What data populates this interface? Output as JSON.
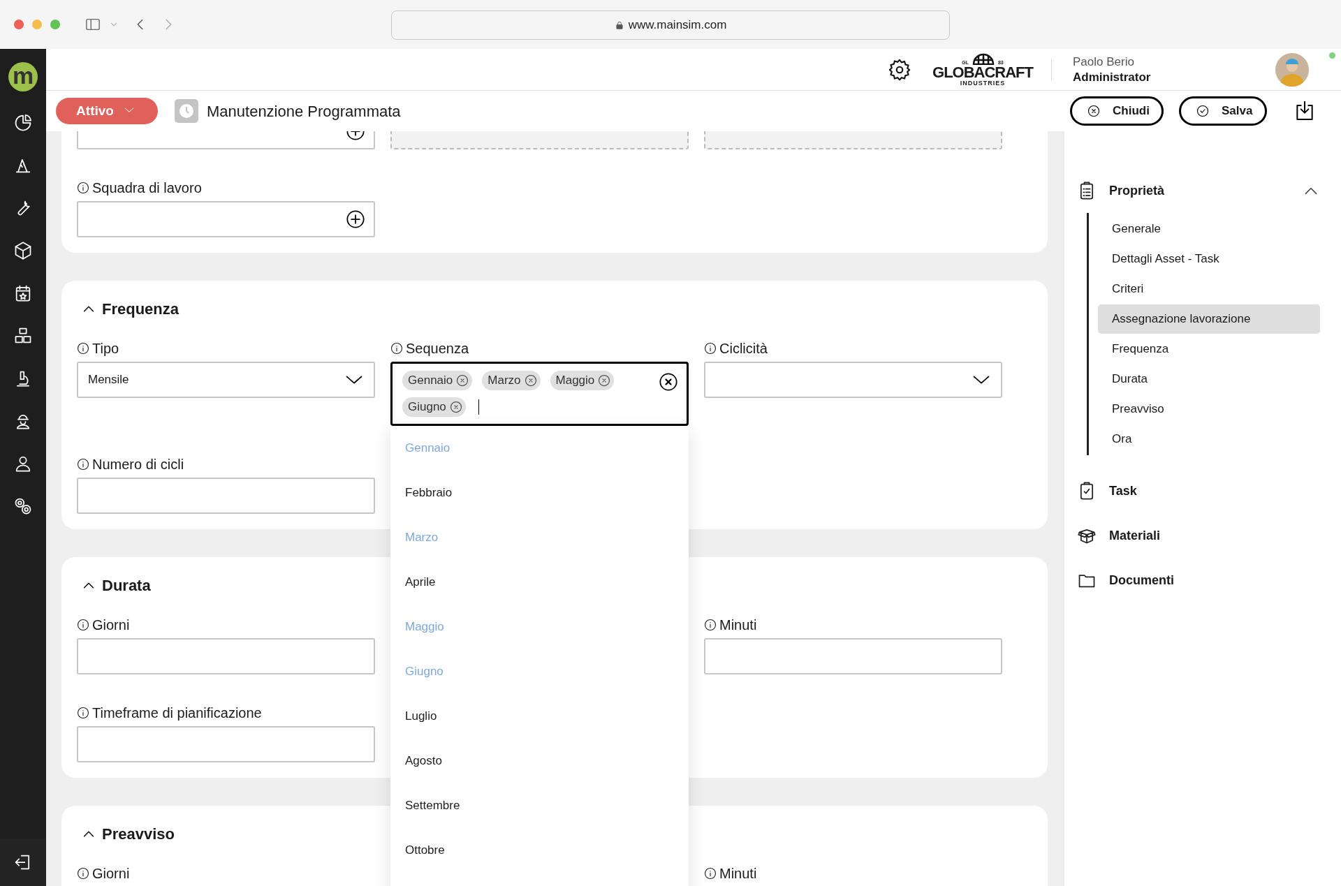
{
  "browser": {
    "url": "www.mainsim.com"
  },
  "sidebar": {
    "logo": "m"
  },
  "header": {
    "brand": {
      "name": "GLOBACRAFT",
      "left_mark": "GL",
      "right_mark": "83",
      "tagline": "INDUSTRIES"
    },
    "user": {
      "name": "Paolo Berio",
      "role": "Administrator"
    }
  },
  "toolbar": {
    "status": "Attivo",
    "title": "Manutenzione Programmata",
    "buttons": [
      {
        "label": "Chiudi",
        "kind": "close"
      },
      {
        "label": "Salva",
        "kind": "save"
      }
    ]
  },
  "sections": [
    {
      "rows": [
        [
          {
            "kind": "add"
          },
          {
            "kind": "dashed"
          },
          {
            "kind": "dashed"
          }
        ],
        [
          {
            "kind": "add",
            "label": "Squadra di lavoro"
          },
          null,
          null
        ]
      ]
    },
    {
      "title": "Frequenza",
      "expanded": true,
      "rows": [
        [
          {
            "kind": "select",
            "label": "Tipo",
            "value": "Mensile"
          },
          {
            "kind": "multiselect",
            "label": "Sequenza",
            "open": true,
            "chips": [
              "Gennaio",
              "Marzo",
              "Maggio",
              "Giugno"
            ],
            "options": [
              {
                "label": "Gennaio",
                "selected": true
              },
              {
                "label": "Febbraio",
                "selected": false
              },
              {
                "label": "Marzo",
                "selected": true
              },
              {
                "label": "Aprile",
                "selected": false
              },
              {
                "label": "Maggio",
                "selected": true
              },
              {
                "label": "Giugno",
                "selected": true
              },
              {
                "label": "Luglio",
                "selected": false
              },
              {
                "label": "Agosto",
                "selected": false
              },
              {
                "label": "Settembre",
                "selected": false
              },
              {
                "label": "Ottobre",
                "selected": false
              }
            ]
          },
          {
            "kind": "select",
            "label": "Ciclicità"
          }
        ],
        [
          {
            "kind": "text",
            "label": "Numero di cicli"
          },
          null,
          null
        ]
      ]
    },
    {
      "title": "Durata",
      "expanded": true,
      "rows": [
        [
          {
            "kind": "text",
            "label": "Giorni"
          },
          null,
          {
            "kind": "text",
            "label": "Minuti"
          }
        ],
        [
          {
            "kind": "text",
            "label": "Timeframe di pianificazione"
          },
          null,
          null
        ]
      ]
    },
    {
      "title": "Preavviso",
      "expanded": true,
      "rows": [
        [
          {
            "kind": "label",
            "label": "Giorni"
          },
          null,
          {
            "kind": "label",
            "label": "Minuti"
          }
        ]
      ]
    }
  ],
  "panel": {
    "groups": [
      {
        "label": "Proprietà",
        "kind": "properties",
        "expanded": true,
        "children": [
          {
            "label": "Generale",
            "selected": false
          },
          {
            "label": "Dettagli Asset - Task",
            "selected": false
          },
          {
            "label": "Criteri",
            "selected": false
          },
          {
            "label": "Assegnazione lavorazione",
            "selected": true
          },
          {
            "label": "Frequenza",
            "selected": false
          },
          {
            "label": "Durata",
            "selected": false
          },
          {
            "label": "Preavviso",
            "selected": false
          },
          {
            "label": "Ora",
            "selected": false
          }
        ]
      },
      {
        "label": "Task",
        "kind": "task"
      },
      {
        "label": "Materiali",
        "kind": "materials"
      },
      {
        "label": "Documenti",
        "kind": "documents"
      }
    ]
  }
}
